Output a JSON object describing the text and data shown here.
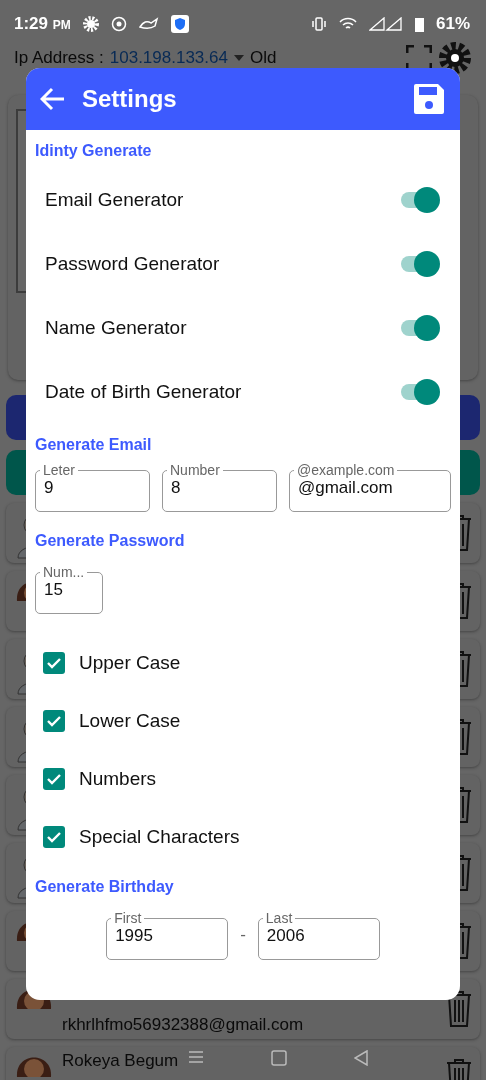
{
  "status_bar": {
    "time": "1:29",
    "meridiem": "PM",
    "battery": "61%"
  },
  "header": {
    "label": "Ip Address :",
    "ip": "103.198.133.64",
    "mode": "Old"
  },
  "contacts": [
    {
      "kind": "male"
    },
    {
      "kind": "female"
    },
    {
      "kind": "male"
    },
    {
      "kind": "male"
    },
    {
      "kind": "male"
    },
    {
      "kind": "male"
    },
    {
      "kind": "female"
    },
    {
      "kind": "female",
      "email": "rkhrlhfmo56932388@gmail.com"
    },
    {
      "kind": "female",
      "name": "Rokeya Begum"
    }
  ],
  "dialog": {
    "title": "Settings",
    "sections": [
      {
        "title": "Idinty Generate",
        "kind": "toggles",
        "items": [
          {
            "label": "Email Generator",
            "on": true
          },
          {
            "label": "Password Generator",
            "on": true
          },
          {
            "label": "Name Generator",
            "on": true
          },
          {
            "label": "Date of Birth Generator",
            "on": true
          }
        ]
      },
      {
        "title": "Generate Email",
        "kind": "fields",
        "fields": [
          {
            "label": "Leter",
            "value": "9"
          },
          {
            "label": "Number",
            "value": "8"
          },
          {
            "label": "@example.com",
            "value": "@gmail.com"
          }
        ]
      },
      {
        "title": "Generate Password",
        "kind": "password",
        "fields": [
          {
            "label": "Num...",
            "value": "15"
          }
        ],
        "items": [
          {
            "label": "Upper Case",
            "checked": true
          },
          {
            "label": "Lower Case",
            "checked": true
          },
          {
            "label": "Numbers",
            "checked": true
          },
          {
            "label": "Special Characters",
            "checked": true
          }
        ]
      },
      {
        "title": "Generate Birthday",
        "kind": "range",
        "fields": [
          {
            "label": "First",
            "value": "1995"
          },
          {
            "label": "Last",
            "value": "2006"
          }
        ],
        "separator": "-"
      }
    ]
  }
}
